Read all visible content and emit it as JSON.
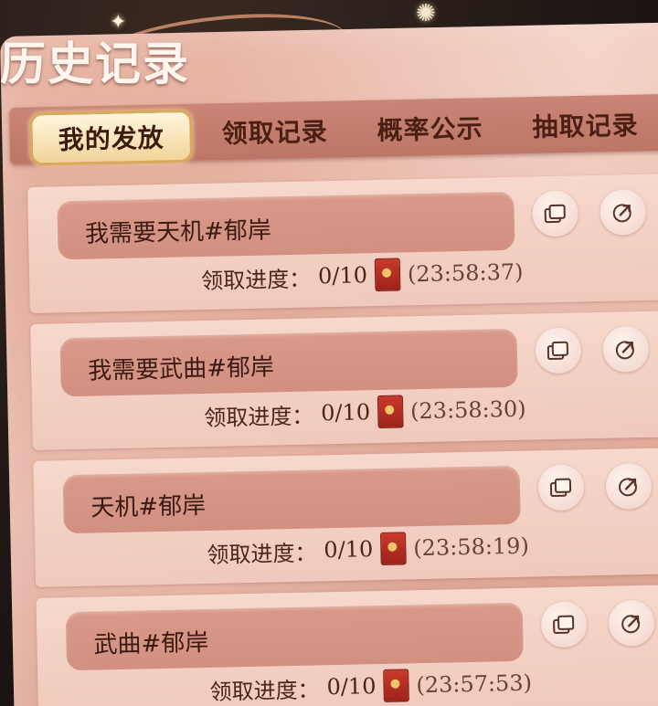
{
  "page": {
    "title": "历史记录"
  },
  "tabs": [
    {
      "label": "我的发放",
      "active": true
    },
    {
      "label": "领取记录",
      "active": false
    },
    {
      "label": "概率公示",
      "active": false
    },
    {
      "label": "抽取记录",
      "active": false
    }
  ],
  "records": [
    {
      "message": "我需要天机#郁岸",
      "progress_label": "领取进度：",
      "progress": "0/10",
      "time": "(23:58:37)"
    },
    {
      "message": "我需要武曲#郁岸",
      "progress_label": "领取进度：",
      "progress": "0/10",
      "time": "(23:58:30)"
    },
    {
      "message": "天机#郁岸",
      "progress_label": "领取进度：",
      "progress": "0/10",
      "time": "(23:58:19)"
    },
    {
      "message": "武曲#郁岸",
      "progress_label": "领取进度：",
      "progress": "0/10",
      "time": "(23:57:53)"
    }
  ],
  "icons": {
    "copy": "copy-icon",
    "share": "share-icon",
    "envelope": "red-envelope-icon"
  },
  "colors": {
    "panel": "#e2ab9b",
    "tabbar": "#c47e6e",
    "active_tab": "#f1d49a",
    "bubble": "#d5958a",
    "card": "#f3d2c5"
  }
}
